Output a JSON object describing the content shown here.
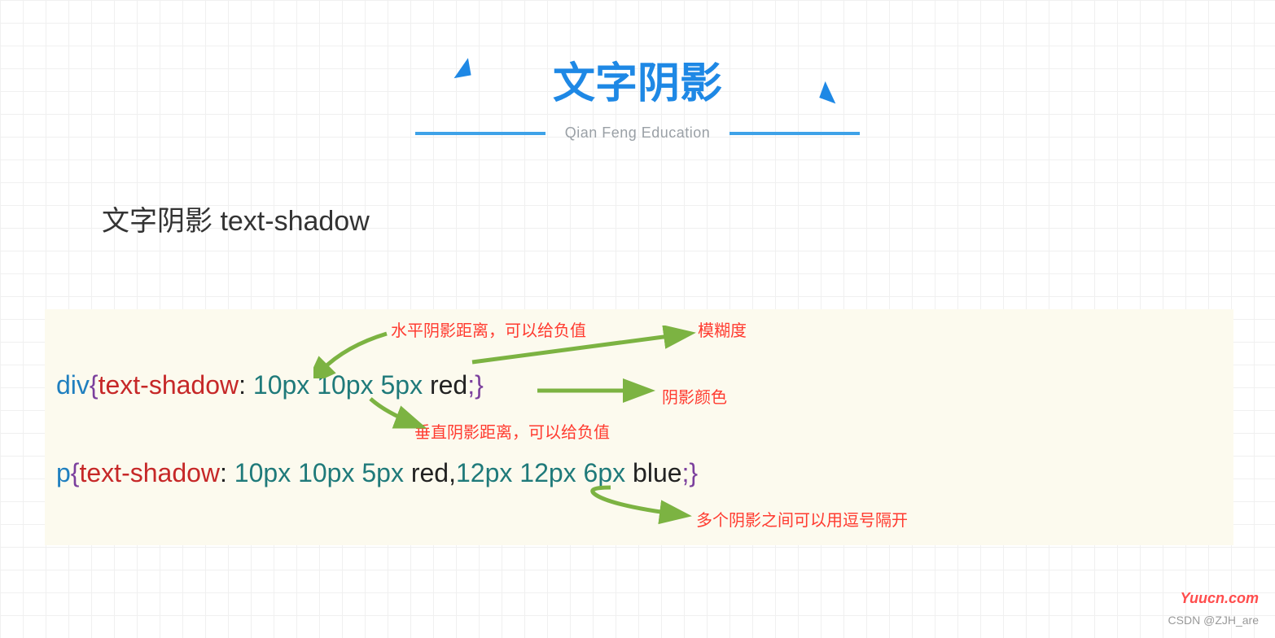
{
  "header": {
    "title": "文字阴影",
    "subtitle": "Qian Feng Education"
  },
  "section_title": "文字阴影  text-shadow",
  "code": {
    "line1": {
      "selector": "div",
      "brace_open": "{",
      "prop": "text-shadow",
      "colon": ": ",
      "v1": "10px",
      "sp": " ",
      "v2": "10px",
      "v3": "5px",
      "v4": "red",
      "semi_brace": ";}"
    },
    "line2": {
      "selector": "p",
      "brace_open": "{",
      "prop": "text-shadow",
      "colon": ": ",
      "v1": "10px",
      "v2": "10px",
      "v3": "5px",
      "v4": "red",
      "comma": ",",
      "v5": "12px",
      "v6": "12px",
      "v7": "6px",
      "v8": "blue",
      "semi_brace": ";}"
    }
  },
  "annotations": {
    "a1": "水平阴影距离，可以给负值",
    "a2": "模糊度",
    "a3": "阴影颜色",
    "a4": "垂直阴影距离，可以给负值",
    "a5": "多个阴影之间可以用逗号隔开"
  },
  "watermark": {
    "w1": "Yuucn.com",
    "w2": "CSDN @ZJH_are"
  }
}
